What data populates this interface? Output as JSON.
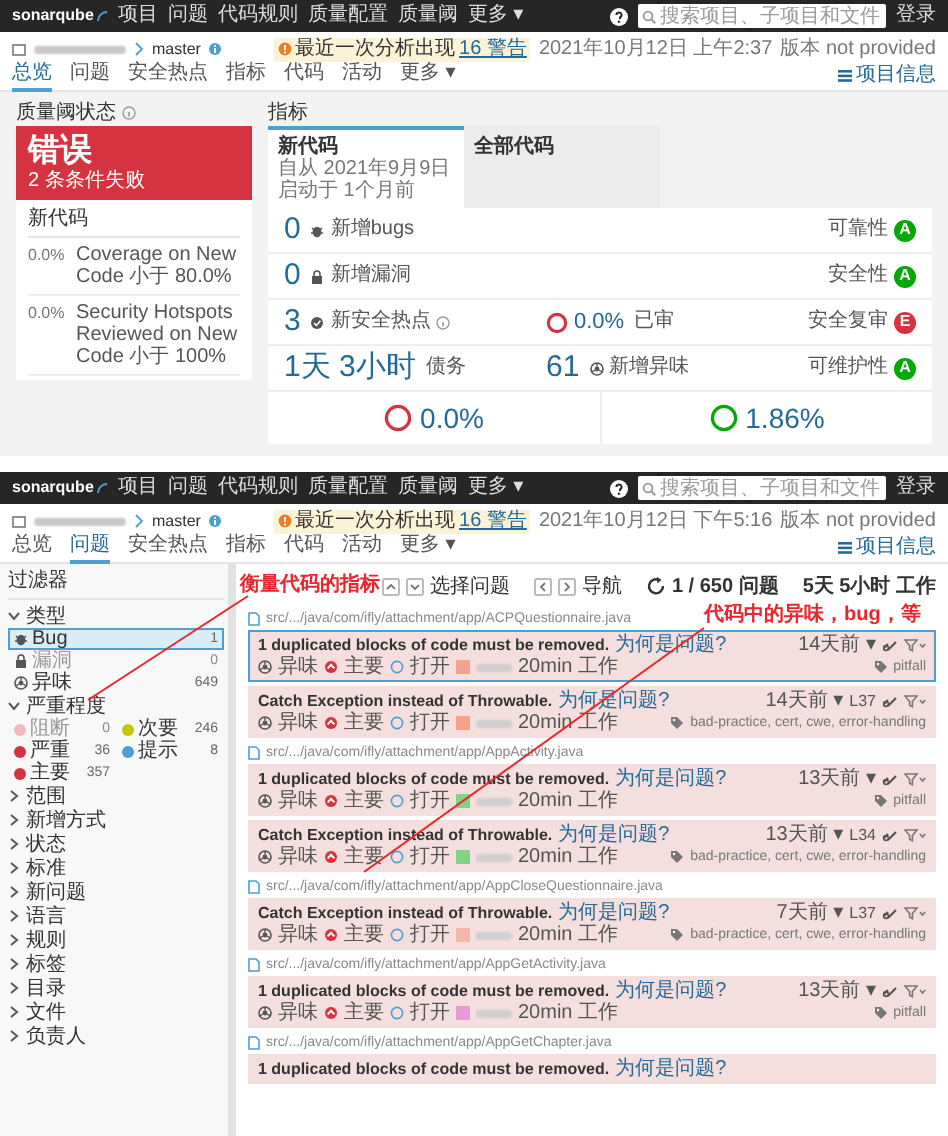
{
  "overview_screen": {
    "nav": {
      "logo": "sonarqube",
      "items": [
        "项目",
        "问题",
        "代码规则",
        "质量配置",
        "质量阈",
        "更多 ▾"
      ],
      "search": {
        "placeholder": "搜索项目、子项目和文件"
      },
      "login": "登录"
    },
    "project": {
      "branch": "master",
      "warning": "最近一次分析出现",
      "warning_link": "16 警告",
      "analysis_date": "2021年10月12日 上午2:37",
      "version": "版本 not provided"
    },
    "tabs": [
      {
        "label": "总览",
        "selected": true
      },
      {
        "label": "问题",
        "selected": false
      },
      {
        "label": "安全热点",
        "selected": false
      },
      {
        "label": "指标",
        "selected": false
      },
      {
        "label": "代码",
        "selected": false
      },
      {
        "label": "活动",
        "selected": false
      },
      {
        "label": "更多 ▾",
        "selected": false
      }
    ],
    "project_info": "项目信息",
    "quality_gate": {
      "title": "质量阈状态",
      "status": "错误",
      "failed": "2 条条件失败",
      "section": "新代码",
      "conditions": [
        {
          "value": "0.0%",
          "text": "Coverage on New Code 小于 80.0%"
        },
        {
          "value": "0.0%",
          "text": "Security Hotspots Reviewed on New Code 小于 100%"
        }
      ]
    },
    "measures": {
      "title": "指标",
      "tabs": [
        {
          "label": "新代码",
          "lines": [
            "自从 2021年9月9日",
            "启动于 1个月前"
          ],
          "selected": true
        },
        {
          "label": "全部代码",
          "selected": false
        }
      ],
      "rows": [
        {
          "value": "0",
          "label": "新增bugs",
          "rating_label": "可靠性",
          "rating": "A",
          "color": "#00aa00"
        },
        {
          "value": "0",
          "label": "新增漏洞",
          "rating_label": "安全性",
          "rating": "A",
          "color": "#00aa00"
        },
        {
          "value": "3",
          "label": "新安全热点",
          "middle": {
            "kind": "ring",
            "value": "0.0%",
            "label": "已审",
            "color": "#d4333f"
          },
          "rating_label": "安全复审",
          "rating": "E",
          "color": "#d4333f"
        },
        {
          "value": "1天 3小时",
          "label": "债务",
          "middle": {
            "kind": "count",
            "value": "61",
            "label": "新增异味"
          },
          "rating_label": "可维护性",
          "rating": "A",
          "color": "#00aa00"
        }
      ],
      "bottom": [
        {
          "value": "0.0%",
          "color": "#d4333f"
        },
        {
          "value": "1.86%",
          "color": "#00aa00"
        }
      ]
    }
  },
  "issues_screen": {
    "nav": {
      "logo": "sonarqube",
      "items": [
        "项目",
        "问题",
        "代码规则",
        "质量配置",
        "质量阈",
        "更多 ▾"
      ],
      "search": {
        "placeholder": "搜索项目、子项目和文件"
      },
      "login": "登录"
    },
    "project": {
      "branch": "master",
      "warning": "最近一次分析出现",
      "warning_link": "16 警告",
      "analysis_date": "2021年10月12日 下午5:16",
      "version": "版本 not provided"
    },
    "tabs": [
      {
        "label": "总览",
        "selected": false
      },
      {
        "label": "问题",
        "selected": true
      },
      {
        "label": "安全热点",
        "selected": false
      },
      {
        "label": "指标",
        "selected": false
      },
      {
        "label": "代码",
        "selected": false
      },
      {
        "label": "活动",
        "selected": false
      },
      {
        "label": "更多 ▾",
        "selected": false
      }
    ],
    "project_info": "项目信息",
    "annotations": [
      {
        "text": "衡量代码的指标"
      },
      {
        "text": "代码中的异味，bug，等"
      }
    ],
    "filters": {
      "title": "过滤器",
      "facets": [
        {
          "label": "类型",
          "expanded": true,
          "kind": "list",
          "items": [
            {
              "label": "Bug",
              "count": "1",
              "selected": true,
              "disabled": false
            },
            {
              "label": "漏洞",
              "count": "0",
              "selected": false,
              "disabled": true
            },
            {
              "label": "异味",
              "count": "649",
              "selected": false,
              "disabled": false
            }
          ]
        },
        {
          "label": "严重程度",
          "expanded": true,
          "kind": "grid",
          "items": [
            {
              "label": "阻断",
              "count": "0",
              "selected": false,
              "disabled": true,
              "color": "#f2b8bc"
            },
            {
              "label": "次要",
              "count": "246",
              "selected": false,
              "disabled": false,
              "color": "#c6c600"
            },
            {
              "label": "严重",
              "count": "36",
              "selected": false,
              "disabled": false,
              "color": "#d4333f"
            },
            {
              "label": "提示",
              "count": "8",
              "selected": false,
              "disabled": false,
              "color": "#4b9fd5"
            },
            {
              "label": "主要",
              "count": "357",
              "selected": false,
              "disabled": false,
              "color": "#d4333f"
            }
          ]
        },
        {
          "label": "范围",
          "expanded": false,
          "kind": "list"
        },
        {
          "label": "新增方式",
          "expanded": false,
          "kind": "list"
        },
        {
          "label": "状态",
          "expanded": false,
          "kind": "list"
        },
        {
          "label": "标准",
          "expanded": false,
          "kind": "list"
        },
        {
          "label": "新问题",
          "expanded": false,
          "kind": "list"
        },
        {
          "label": "语言",
          "expanded": false,
          "kind": "list"
        },
        {
          "label": "规则",
          "expanded": false,
          "kind": "list"
        },
        {
          "label": "标签",
          "expanded": false,
          "kind": "list"
        },
        {
          "label": "目录",
          "expanded": false,
          "kind": "list"
        },
        {
          "label": "文件",
          "expanded": false,
          "kind": "list"
        },
        {
          "label": "负责人",
          "expanded": false,
          "kind": "list"
        }
      ]
    },
    "toolbar": {
      "select": "选择问题",
      "navigate": "导航",
      "count": "1 / 650 问题",
      "effort": "5天 5小时 工作"
    },
    "files": [
      {
        "path": "src/.../java/com/ifly/attachment/app/ACPQuestionnaire.java",
        "issues": [
          {
            "title": "1 duplicated blocks of code must be removed.",
            "why": "为何是问题?",
            "selected": true,
            "age": "14天前 ▾",
            "type": "异味",
            "severity": "主要",
            "status": "打开",
            "color": "#f5a38c",
            "effort": "20min 工作",
            "tags": "pitfall"
          },
          {
            "title": "Catch Exception instead of Throwable.",
            "why": "为何是问题?",
            "selected": false,
            "age": "14天前 ▾",
            "line": "L37",
            "type": "异味",
            "severity": "主要",
            "status": "打开",
            "color": "#f5a38c",
            "effort": "20min 工作",
            "tags": "bad-practice, cert, cwe, error-handling"
          }
        ]
      },
      {
        "path": "src/.../java/com/ifly/attachment/app/AppActivity.java",
        "issues": [
          {
            "title": "1 duplicated blocks of code must be removed.",
            "why": "为何是问题?",
            "selected": false,
            "age": "13天前 ▾",
            "type": "异味",
            "severity": "主要",
            "status": "打开",
            "color": "#7fd48a",
            "effort": "20min 工作",
            "tags": "pitfall"
          },
          {
            "title": "Catch Exception instead of Throwable.",
            "why": "为何是问题?",
            "selected": false,
            "age": "13天前 ▾",
            "line": "L34",
            "type": "异味",
            "severity": "主要",
            "status": "打开",
            "color": "#7fd48a",
            "effort": "20min 工作",
            "tags": "bad-practice, cert, cwe, error-handling"
          }
        ]
      },
      {
        "path": "src/.../java/com/ifly/attachment/app/AppCloseQuestionnaire.java",
        "issues": [
          {
            "title": "Catch Exception instead of Throwable.",
            "why": "为何是问题?",
            "selected": false,
            "age": "7天前 ▾",
            "line": "L37",
            "type": "异味",
            "severity": "主要",
            "status": "打开",
            "color": "#f5b8a8",
            "effort": "20min 工作",
            "tags": "bad-practice, cert, cwe, error-handling"
          }
        ]
      },
      {
        "path": "src/.../java/com/ifly/attachment/app/AppGetActivity.java",
        "issues": [
          {
            "title": "1 duplicated blocks of code must be removed.",
            "why": "为何是问题?",
            "selected": false,
            "age": "13天前 ▾",
            "type": "异味",
            "severity": "主要",
            "status": "打开",
            "color": "#e79bd4",
            "effort": "20min 工作",
            "tags": "pitfall"
          }
        ]
      },
      {
        "path": "src/.../java/com/ifly/attachment/app/AppGetChapter.java",
        "issues": [
          {
            "title": "1 duplicated blocks of code must be removed.",
            "why": "为何是问题?",
            "selected": false
          }
        ]
      }
    ]
  }
}
